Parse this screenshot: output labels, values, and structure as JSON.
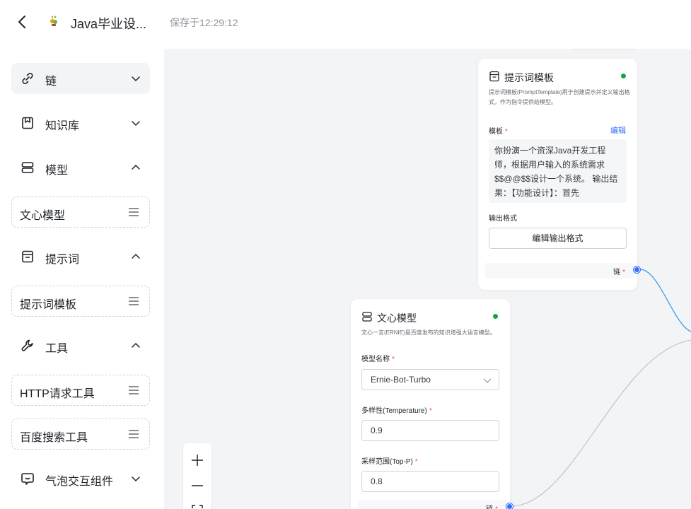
{
  "header": {
    "title": "Java毕业设...",
    "save_status": "保存于12:29:12"
  },
  "sidebar": {
    "groups": [
      {
        "label": "链",
        "icon": "link-icon",
        "expanded": false,
        "active": true
      },
      {
        "label": "知识库",
        "icon": "knowledge-base-icon",
        "expanded": false
      },
      {
        "label": "模型",
        "icon": "model-icon",
        "expanded": true,
        "items": [
          "文心模型"
        ]
      },
      {
        "label": "提示词",
        "icon": "prompt-icon",
        "expanded": true,
        "items": [
          "提示词模板"
        ]
      },
      {
        "label": "工具",
        "icon": "wrench-icon",
        "expanded": true,
        "items": [
          "HTTP请求工具",
          "百度搜索工具"
        ]
      },
      {
        "label": "气泡交互组件",
        "icon": "chat-bubble-icon",
        "expanded": false
      }
    ]
  },
  "nodes": {
    "prompt_template": {
      "title": "提示词模板",
      "description": "提示词模板(PromptTemplate)用于创建提示并定义输出格式，作为指令提供给模型。",
      "template_label": "模板",
      "edit_label": "编辑",
      "template_text": "你扮演一个资深Java开发工程师，根据用户输入的系统需求$$@@$$设计一个系统。 输出结果：【功能设计】：首先",
      "output_format_label": "输出格式",
      "edit_output_format_button": "编辑输出格式",
      "chain_label": "链"
    },
    "wenxin_model": {
      "title": "文心模型",
      "description": "文心一言(ERNIE)是百度发布的知识增强大语言模型。",
      "model_name_label": "模型名称",
      "model_name_value": "Ernie-Bot-Turbo",
      "temperature_label": "多样性(Temperature)",
      "temperature_value": "0.9",
      "top_p_label": "采样范围(Top-P)",
      "top_p_value": "0.8",
      "chain_label": "链"
    }
  },
  "colors": {
    "accent": "#3370ff",
    "status_ok": "#16a34a",
    "required": "#f54a45",
    "canvas_bg": "#f3f4f6"
  }
}
